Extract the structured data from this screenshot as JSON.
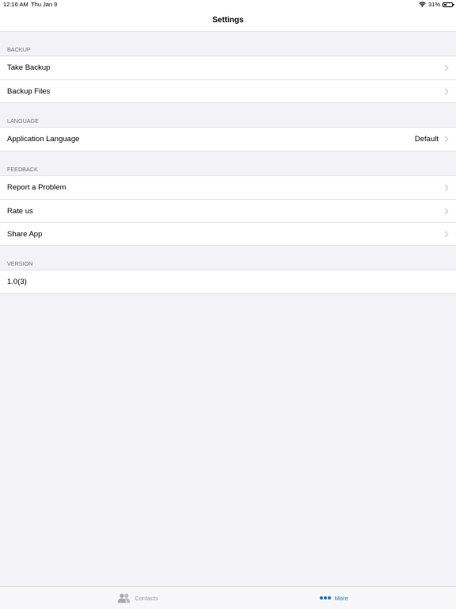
{
  "status_bar": {
    "time": "12:16 AM",
    "date": "Thu Jan 9",
    "battery": "31%",
    "battery_level": 0.31
  },
  "nav": {
    "title": "Settings"
  },
  "sections": {
    "backup": {
      "header": "BACKUP",
      "rows": [
        "Take Backup",
        "Backup Files"
      ]
    },
    "language": {
      "header": "LANGUAGE",
      "row_label": "Application Language",
      "row_value": "Default"
    },
    "feedback": {
      "header": "FEEDBACK",
      "rows": [
        "Report a Problem",
        "Rate us",
        "Share App"
      ]
    },
    "version": {
      "header": "VERSION",
      "value": "1.0(3)"
    }
  },
  "tab_bar": {
    "tabs": [
      {
        "label": "Contacts",
        "icon": "contacts-icon",
        "selected": false
      },
      {
        "label": "More",
        "icon": "more-icon",
        "selected": true
      }
    ]
  },
  "colors": {
    "accent": "#1f79c7",
    "background": "#f2f2f7",
    "separator": "#e3e3e8",
    "inactive_tab": "#9a9a9e"
  }
}
